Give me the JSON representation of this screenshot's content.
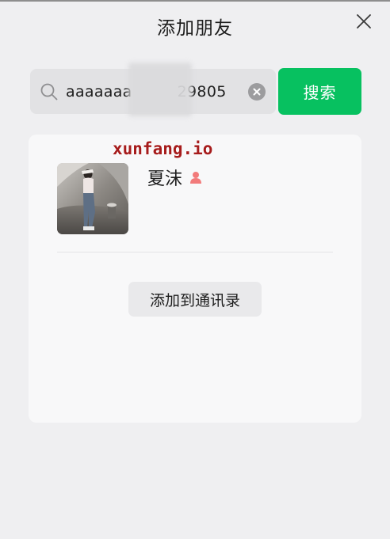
{
  "dialog": {
    "title": "添加朋友"
  },
  "search": {
    "value": "aaaaaaa         29805",
    "button_label": "搜索"
  },
  "result": {
    "watermark": "xunfang.io",
    "name": "夏沫",
    "gender_icon": "female-icon",
    "add_button_label": "添加到通讯录"
  },
  "colors": {
    "accent": "#07c160",
    "background": "#efeff1",
    "card": "#f8f8f9",
    "female": "#f27b7b"
  },
  "icons": [
    "close-icon",
    "search-icon",
    "clear-icon",
    "female-icon"
  ]
}
